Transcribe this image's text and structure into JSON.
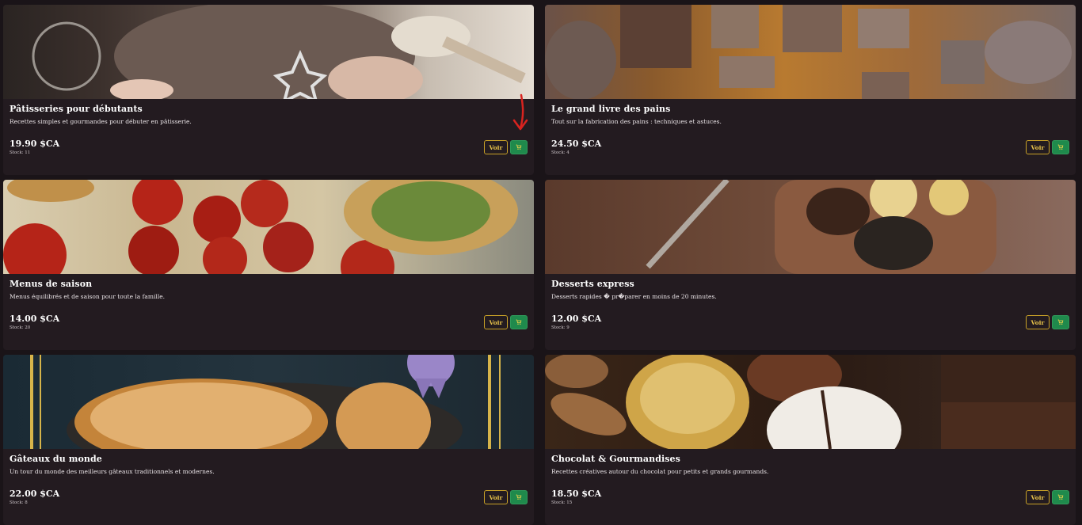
{
  "catalog": {
    "products": [
      {
        "title": "Pâtisseries pour débutants",
        "description": "Recettes simples et gourmandes pour débuter en pâtisserie.",
        "price": "19.90 $CA",
        "stock": "Stock: 11",
        "view_label": "Voir",
        "image": "baking-photo"
      },
      {
        "title": "Le grand livre des pains",
        "description": "Tout sur la fabrication des pains : techniques et astuces.",
        "price": "24.50 $CA",
        "stock": "Stock: 4",
        "view_label": "Voir",
        "image": "bread-photo"
      },
      {
        "title": "Menus de saison",
        "description": "Menus équilibrés et de saison pour toute la famille.",
        "price": "14.00 $CA",
        "stock": "Stock: 20",
        "view_label": "Voir",
        "image": "tomato-tart-photo"
      },
      {
        "title": "Desserts express",
        "description": "Desserts rapides � pr�parer en moins de 20 minutes.",
        "price": "12.00 $CA",
        "stock": "Stock: 9",
        "view_label": "Voir",
        "image": "chocolate-dessert-photo"
      },
      {
        "title": "Gâteaux du monde",
        "description": "Un tour du monde des meilleurs gâteaux traditionnels et modernes.",
        "price": "22.00 $CA",
        "stock": "Stock: 8",
        "view_label": "Voir",
        "image": "pie-photo"
      },
      {
        "title": "Chocolat & Gourmandises",
        "description": "Recettes créatives autour du chocolat pour petits et grands gourmands.",
        "price": "18.50 $CA",
        "stock": "Stock: 15",
        "view_label": "Voir",
        "image": "chocolates-photo"
      }
    ]
  },
  "colors": {
    "background": "#1a1418",
    "card": "#231b20",
    "accent_gold": "#c9a227",
    "cart_green": "#1f8a4c",
    "annotation_red": "#d9231f"
  },
  "icons": {
    "cart": "cart-icon",
    "annotation": "red-arrow-annotation"
  }
}
